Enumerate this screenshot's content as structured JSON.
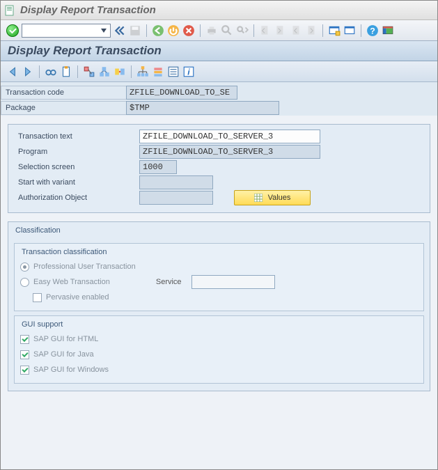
{
  "window": {
    "title": "Display Report Transaction",
    "page_title": "Display Report Transaction"
  },
  "header_fields": {
    "transaction_code_label": "Transaction code",
    "transaction_code_value": "ZFILE_DOWNLOAD_TO_SE",
    "package_label": "Package",
    "package_value": "$TMP"
  },
  "detail_fields": {
    "transaction_text_label": "Transaction text",
    "transaction_text_value": "ZFILE_DOWNLOAD_TO_SERVER_3",
    "program_label": "Program",
    "program_value": "ZFILE_DOWNLOAD_TO_SERVER_3",
    "selection_screen_label": "Selection screen",
    "selection_screen_value": "1000",
    "start_with_variant_label": "Start with variant",
    "start_with_variant_value": "",
    "authorization_object_label": "Authorization Object",
    "authorization_object_value": "",
    "values_button": "Values"
  },
  "classification": {
    "group_title": "Classification",
    "trans_class_title": "Transaction classification",
    "professional_label": "Professional User Transaction",
    "professional_selected": true,
    "easy_web_label": "Easy Web Transaction",
    "service_label": "Service",
    "service_value": "",
    "pervasive_label": "Pervasive enabled",
    "pervasive_checked": false,
    "gui_support_title": "GUI support",
    "gui_html_label": "SAP GUI for HTML",
    "gui_html_checked": true,
    "gui_java_label": "SAP GUI for Java",
    "gui_java_checked": true,
    "gui_windows_label": "SAP GUI for Windows",
    "gui_windows_checked": true
  }
}
